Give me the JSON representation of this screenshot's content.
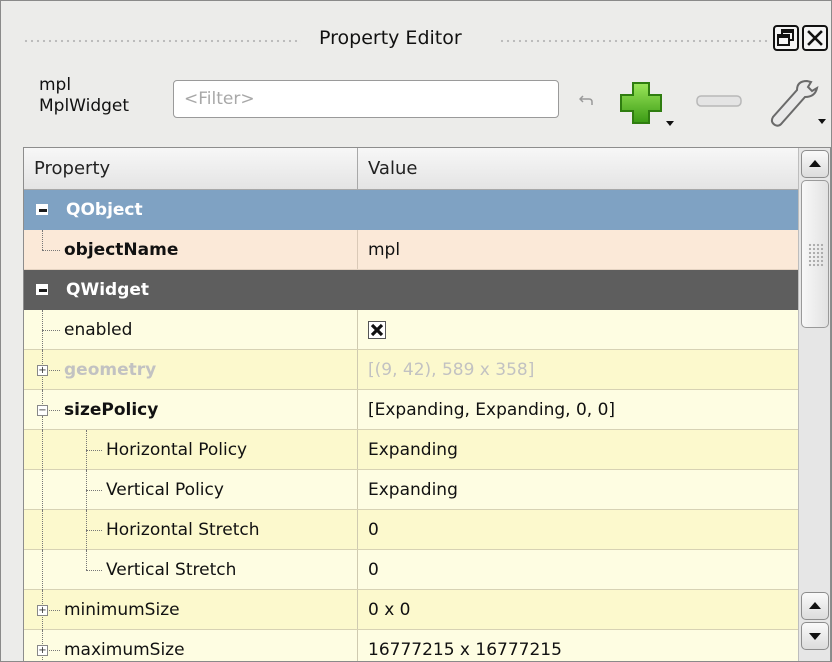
{
  "window": {
    "title": "Property Editor"
  },
  "toolbar": {
    "object_name": "mpl",
    "class_name": "MplWidget",
    "filter_placeholder": "<Filter>",
    "filter_value": "",
    "icons": [
      "reset-arrow-icon",
      "add-plus-icon",
      "remove-minus-icon",
      "wrench-icon"
    ]
  },
  "colors": {
    "qobject_group": "#7fa2c3",
    "qwidget_group": "#5e5e5e",
    "selected_row": "#fbe9d8",
    "property_row": "#fefde2",
    "property_row_alt": "#fcf9cd"
  },
  "table": {
    "columns": [
      "Property",
      "Value"
    ],
    "groups": [
      {
        "label": "QObject"
      },
      {
        "label": "QWidget"
      }
    ],
    "rows": [
      {
        "property": "objectName",
        "value": "mpl"
      },
      {
        "property": "enabled",
        "value": "checked"
      },
      {
        "property": "geometry",
        "value": "[(9, 42), 589 x 358]"
      },
      {
        "property": "sizePolicy",
        "value": "[Expanding, Expanding, 0, 0]"
      },
      {
        "property": "Horizontal Policy",
        "value": "Expanding"
      },
      {
        "property": "Vertical Policy",
        "value": "Expanding"
      },
      {
        "property": "Horizontal Stretch",
        "value": "0"
      },
      {
        "property": "Vertical Stretch",
        "value": "0"
      },
      {
        "property": "minimumSize",
        "value": "0 x 0"
      },
      {
        "property": "maximumSize",
        "value": "16777215 x 16777215"
      }
    ]
  }
}
